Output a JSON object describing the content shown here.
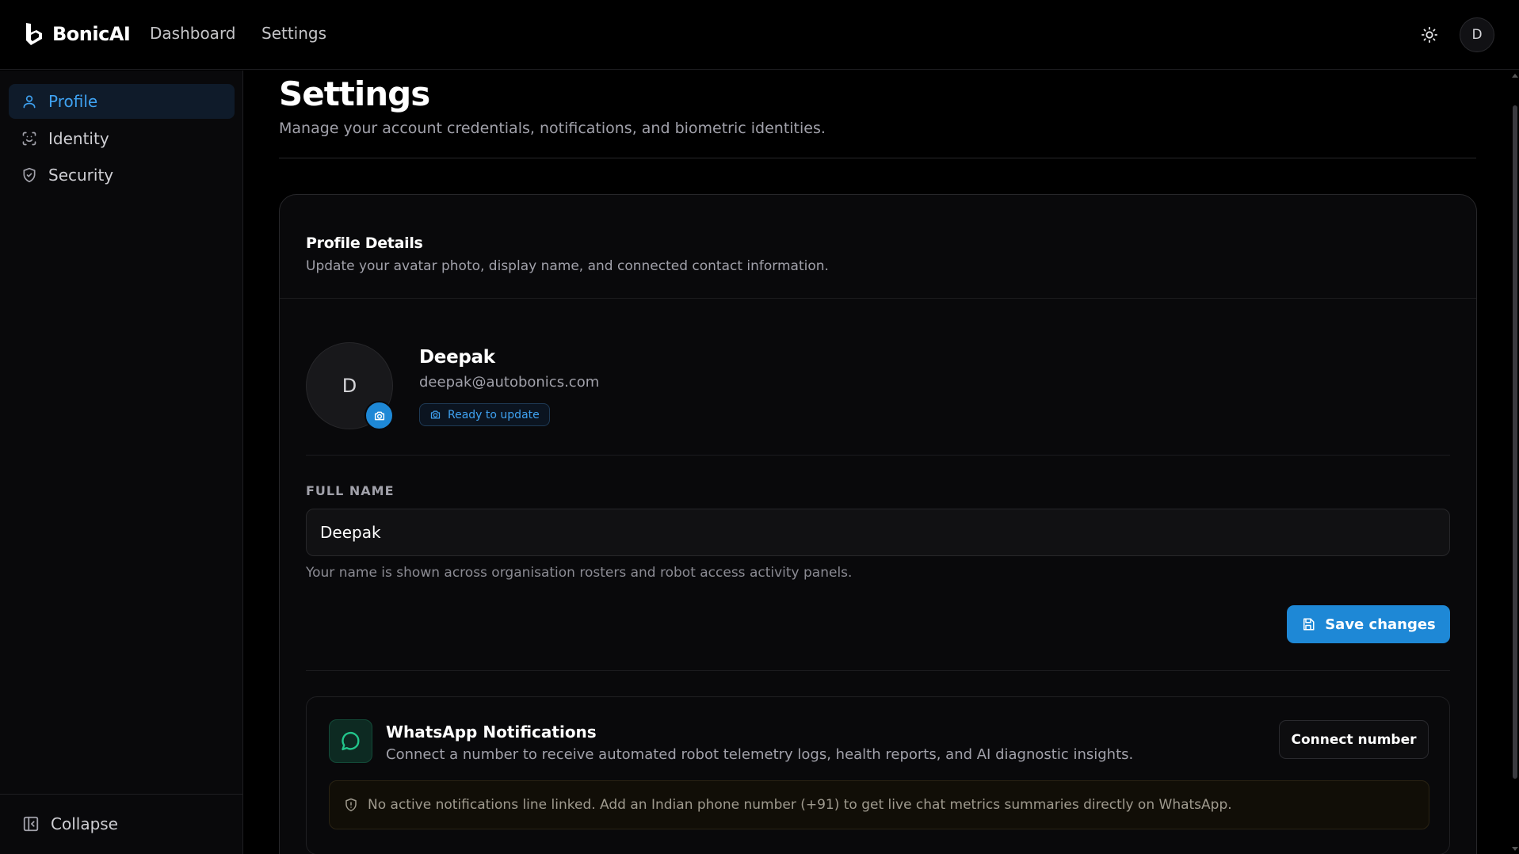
{
  "app": {
    "brand": "BonicAI"
  },
  "nav": {
    "dashboard": "Dashboard",
    "settings": "Settings"
  },
  "header": {
    "theme_icon": "sun-icon",
    "user_initial": "D"
  },
  "sidebar": {
    "items": [
      {
        "label": "Profile",
        "icon": "user-icon",
        "active": true
      },
      {
        "label": "Identity",
        "icon": "scan-face-icon",
        "active": false
      },
      {
        "label": "Security",
        "icon": "shield-check-icon",
        "active": false
      }
    ],
    "collapse_label": "Collapse"
  },
  "page": {
    "title": "Settings",
    "subtitle": "Manage your account credentials, notifications, and biometric identities."
  },
  "profile_card": {
    "title": "Profile Details",
    "subtitle": "Update your avatar photo, display name, and connected contact information.",
    "avatar_initial": "D",
    "name": "Deepak",
    "email": "deepak@autobonics.com",
    "status": "Ready to update",
    "field_label": "FULL NAME",
    "field_value": "Deepak",
    "field_help": "Your name is shown across organisation rosters and robot access activity panels.",
    "save_label": "Save changes"
  },
  "whatsapp": {
    "title": "WhatsApp Notifications",
    "subtitle": "Connect a number to receive automated robot telemetry logs, health reports, and AI diagnostic insights.",
    "button_label": "Connect number",
    "alert": "No active notifications line linked. Add an Indian phone number (+91) to get live chat metrics summaries directly on WhatsApp."
  },
  "colors": {
    "accent": "#1e88d6",
    "accent_text": "#3fa2f1",
    "background": "#000000",
    "whatsapp_green": "#22c58b"
  }
}
